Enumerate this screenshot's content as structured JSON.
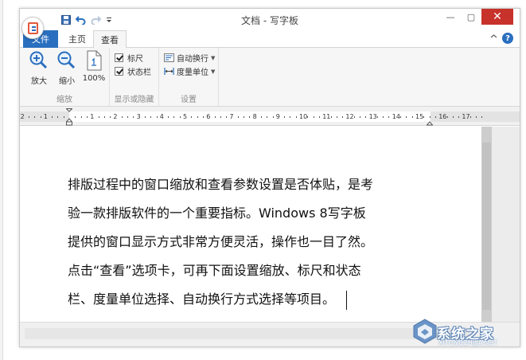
{
  "window": {
    "title": "文档 - 写字板",
    "controls": {
      "minimize": "—",
      "maximize": "▢",
      "close": "✕"
    }
  },
  "ribbon": {
    "tabs": [
      {
        "label": "文件",
        "active": false
      },
      {
        "label": "主页",
        "active": false
      },
      {
        "label": "查看",
        "active": true
      }
    ],
    "help_label": "?",
    "groups": {
      "zoom": {
        "label": "缩放",
        "buttons": [
          {
            "label": "放大",
            "icon": "zoom-in-icon"
          },
          {
            "label": "缩小",
            "icon": "zoom-out-icon"
          },
          {
            "label": "100%",
            "icon": "page-100-icon"
          }
        ]
      },
      "show_hide": {
        "label": "显示或隐藏",
        "options": [
          {
            "label": "标尺",
            "checked": true
          },
          {
            "label": "状态栏",
            "checked": true
          }
        ]
      },
      "settings": {
        "label": "设置",
        "options": [
          {
            "label": "自动换行",
            "icon": "word-wrap-icon"
          },
          {
            "label": "度量单位",
            "icon": "measure-unit-icon"
          }
        ]
      }
    }
  },
  "ruler": {
    "left_labels": [
      "2",
      "1"
    ],
    "numbers": [
      "1",
      "2",
      "3",
      "4",
      "5",
      "6",
      "7",
      "8",
      "9",
      "10",
      "11",
      "12",
      "13",
      "14",
      "15",
      "16",
      "17"
    ]
  },
  "document": {
    "lines": [
      "排版过程中的窗口缩放和查看参数设置是否体贴，是考",
      "验一款排版软件的一个重要指标。Windows 8写字板",
      "提供的窗口显示方式非常方便灵活，操作也一目了然。",
      "点击“查看”选项卡，可再下面设置缩放、标尺和状态",
      "栏、度量单位选择、自动换行方式选择等项目。"
    ]
  },
  "watermark": {
    "text": "系统之家",
    "sub": "XITONGZHIJIA.NET"
  },
  "colors": {
    "accent": "#2a6fbf",
    "close": "#c7322b",
    "ribbon_bg": "#f6f6f6"
  }
}
